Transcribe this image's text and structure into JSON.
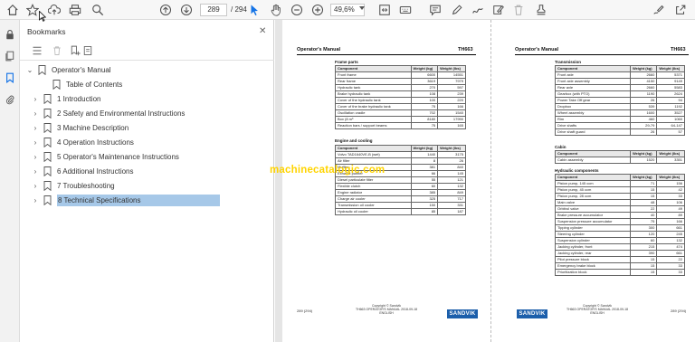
{
  "toolbar": {
    "page_current": "289",
    "page_total": "/ 294",
    "zoom": "49,6%"
  },
  "bookmarks_panel": {
    "title": "Bookmarks",
    "items": [
      {
        "label": "Operator's Manual",
        "level": 0,
        "expanded": true
      },
      {
        "label": "Table of Contents",
        "level": 1,
        "expanded": false
      },
      {
        "label": "1 Introduction",
        "level": 1,
        "expanded": false
      },
      {
        "label": "2 Safety and Environmental Instructions",
        "level": 1,
        "expanded": false
      },
      {
        "label": "3 Machine Description",
        "level": 1,
        "expanded": false
      },
      {
        "label": "4 Operation Instructions",
        "level": 1,
        "expanded": false
      },
      {
        "label": "5 Operator's Maintenance Instructions",
        "level": 1,
        "expanded": false
      },
      {
        "label": "6 Additional Instructions",
        "level": 1,
        "expanded": false
      },
      {
        "label": "7 Troubleshooting",
        "level": 1,
        "expanded": false
      },
      {
        "label": "8 Technical Specifications",
        "level": 1,
        "expanded": false,
        "selected": true
      }
    ]
  },
  "document": {
    "watermark": "machinecatalogic.com",
    "left_page": {
      "header_left": "Operator's Manual",
      "header_right": "TH663",
      "sections": [
        {
          "title": "Frame parts",
          "columns": [
            "Component",
            "Weight (kg)",
            "Weight (lbs)"
          ],
          "rows": [
            [
              "Front frame",
              "6600",
              "14551"
            ],
            [
              "Rear frame",
              "3619",
              "7979"
            ],
            [
              "Hydraulic tank",
              "270",
              "597"
            ],
            [
              "Brake hydraulic tank",
              "108",
              "239"
            ],
            [
              "Cover of the hydraulic tank",
              "100",
              "220"
            ],
            [
              "Cover of the brake hydraulic tank",
              "75",
              "166"
            ],
            [
              "Oscillation cradle",
              "702",
              "1540"
            ],
            [
              "Box (8 m³",
              "8180",
              "17990"
            ],
            [
              "Reaction bars / support beams",
              "75",
              "165"
            ]
          ]
        },
        {
          "title": "Engine and cooling",
          "columns": [
            "Component",
            "Weight (kg)",
            "Weight (lbs)"
          ],
          "rows": [
            [
              "Volvo TAD1640VE-B (wet)",
              "1440",
              "3175"
            ],
            [
              "Air filter",
              "8",
              "26"
            ],
            [
              "Muffler",
              "381",
              "840"
            ],
            [
              "Exhaust purifier",
              "66",
              "145"
            ],
            [
              "Diesel particulate filter",
              "55",
              "121"
            ],
            [
              "Flexible clutch",
              "60",
              "132"
            ],
            [
              "Engine radiator",
              "385",
              "849"
            ],
            [
              "Charge air cooler",
              "325",
              "717"
            ],
            [
              "Transmission oil cooler",
              "150",
              "331"
            ],
            [
              "Hydraulic oil cooler",
              "85",
              "187"
            ]
          ]
        }
      ],
      "footer_page": "289 (294)",
      "footer_copyright": "Copyright © Sandvik",
      "footer_doc": "TH663 OPERATOR'S MANUAL 2018-09-18 ENGLISH",
      "logo": "SANDVIK"
    },
    "right_page": {
      "header_left": "Operator's Manual",
      "header_right": "TH663",
      "sections": [
        {
          "title": "Transmission",
          "columns": [
            "Component",
            "Weight (kg)",
            "Weight (lbs)"
          ],
          "rows": [
            [
              "Front axle",
              "2660",
              "5371"
            ],
            [
              "Front axle assembly",
              "4150",
              "9149"
            ],
            [
              "Rear axle",
              "2660",
              "5583"
            ],
            [
              "Gearbox (with PTO)",
              "1190",
              "2624"
            ],
            [
              "Power Take Off gear",
              "26",
              "94"
            ],
            [
              "Dropbox",
              "539",
              "1192"
            ],
            [
              "Wheel assembly",
              "1600",
              "3527"
            ],
            [
              "Rim",
              "460",
              "1060"
            ],
            [
              "Drive shafts",
              "29-79",
              "64-147"
            ],
            [
              "Drive shaft guard",
              "26",
              "57"
            ]
          ]
        },
        {
          "title": "Cabin",
          "columns": [
            "Component",
            "Weight (kg)",
            "Weight (lbs)"
          ],
          "rows": [
            [
              "Cabin assembly",
              "1520",
              "3351"
            ]
          ]
        },
        {
          "title": "Hydraulic components",
          "columns": [
            "Component",
            "Weight (kg)",
            "Weight (lbs)"
          ],
          "rows": [
            [
              "Piston pump, 145 ccm",
              "71",
              "156"
            ],
            [
              "Piston pump, 45 ccm",
              "15",
              "42"
            ],
            [
              "Piston pump, 28 ccm",
              "15",
              "33"
            ],
            [
              "Main valve",
              "48",
              "106"
            ],
            [
              "Orbitrol valve",
              "22",
              "49"
            ],
            [
              "Brake pressure accumulator",
              "40",
              "89"
            ],
            [
              "Suspension pressure accumulator",
              "75",
              "166"
            ],
            [
              "Tipping cylinder",
              "300",
              "661"
            ],
            [
              "Steering cylinder",
              "120",
              "245"
            ],
            [
              "Suspension cylinder",
              "60",
              "132"
            ],
            [
              "Jacking cylinder, front",
              "215",
              "474"
            ],
            [
              "Jacking cylinder, rear",
              "390",
              "661"
            ],
            [
              "Pilot pressure block",
              "15",
              "22"
            ],
            [
              "Emergency brake block",
              "15",
              "33"
            ],
            [
              "Prioritization block",
              "15",
              "33"
            ]
          ]
        }
      ],
      "footer_page": "289 (294)",
      "footer_copyright": "Copyright © Sandvik",
      "footer_doc": "TH663 OPERATOR'S MANUAL 2018-09-18 ENGLISH",
      "logo": "SANDVIK"
    }
  }
}
